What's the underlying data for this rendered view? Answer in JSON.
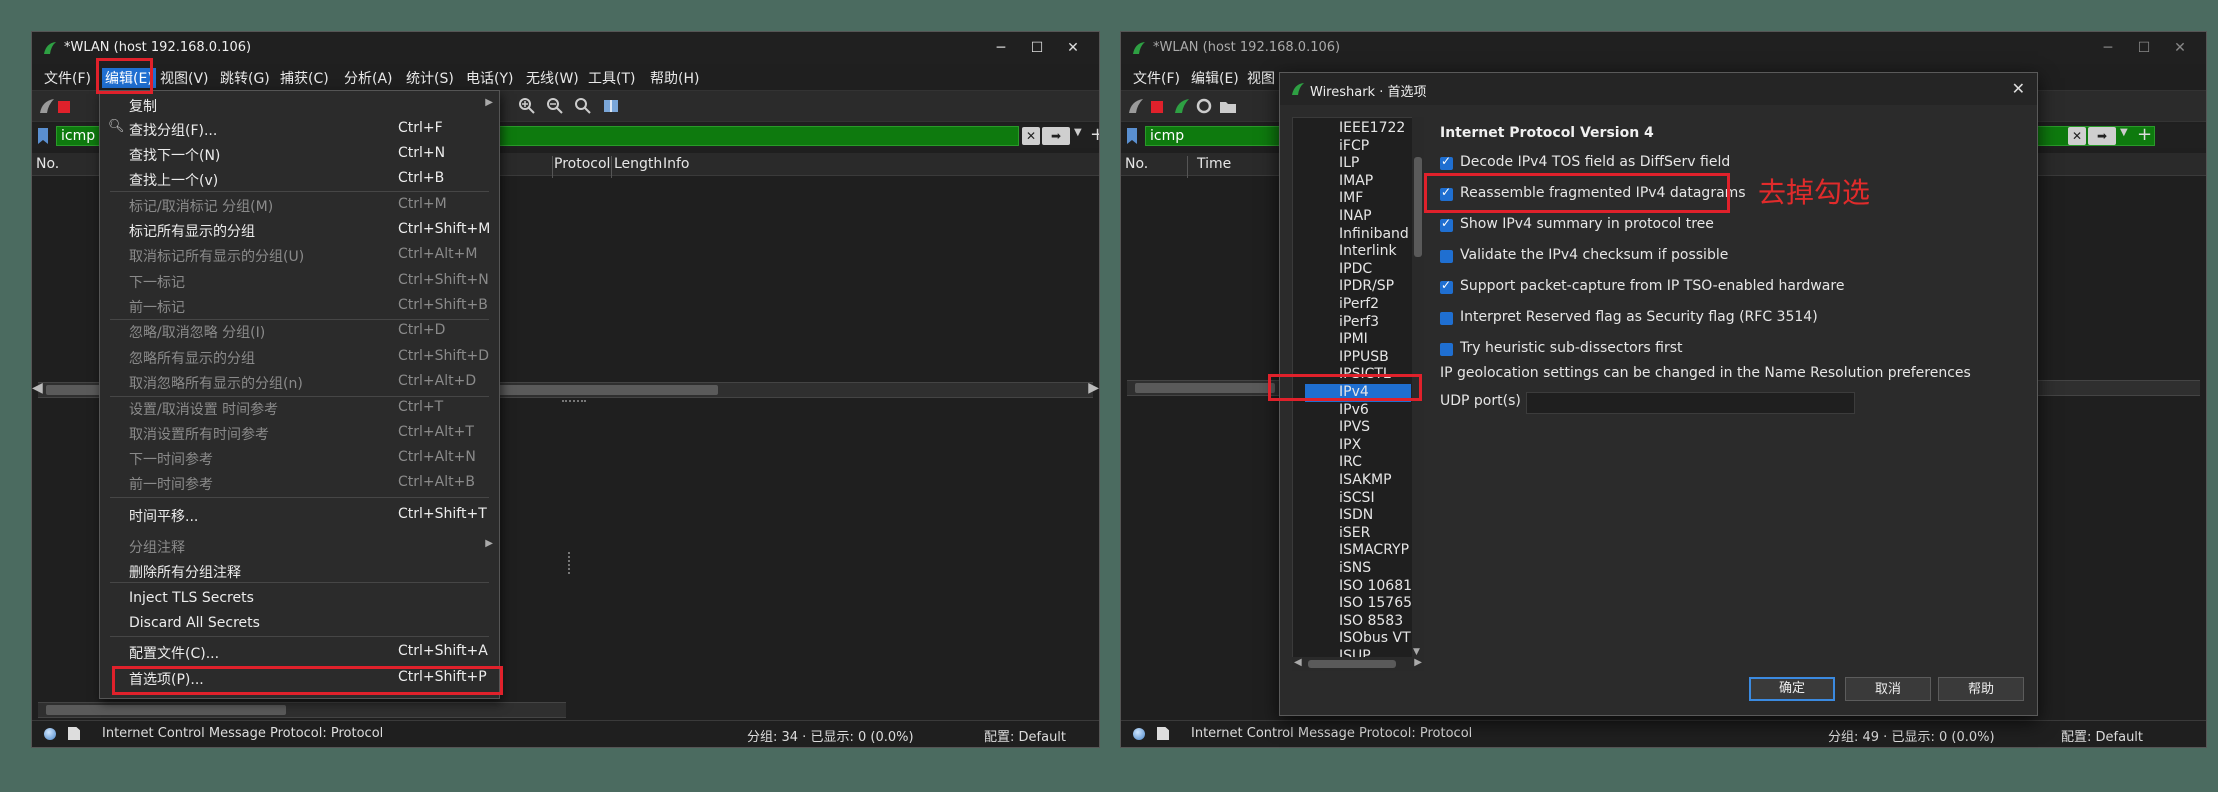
{
  "colors": {
    "accent": "#1f6fd1",
    "filter_green": "#0e7a0e",
    "highlight_red": "#e0212b"
  },
  "window1": {
    "title": "*WLAN (host 192.168.0.106)",
    "menu": [
      "文件(F)",
      "编辑(E)",
      "视图(V)",
      "跳转(G)",
      "捕获(C)",
      "分析(A)",
      "统计(S)",
      "电话(Y)",
      "无线(W)",
      "工具(T)",
      "帮助(H)"
    ],
    "filter_text": "icmp",
    "columns": {
      "no": "No.",
      "protocol": "Protocol",
      "length": "Length",
      "info": "Info"
    },
    "status": {
      "protocol": "Internet Control Message Protocol: Protocol",
      "packets": "分组: 34 · 已显示: 0 (0.0%)",
      "profile": "配置: Default"
    },
    "edit_menu": [
      {
        "label": "复制",
        "shortcut": "",
        "submenu": true,
        "enabled": true
      },
      {
        "label": "查找分组(F)...",
        "shortcut": "Ctrl+F",
        "enabled": true
      },
      {
        "label": "查找下一个(N)",
        "shortcut": "Ctrl+N",
        "enabled": true
      },
      {
        "label": "查找上一个(v)",
        "shortcut": "Ctrl+B",
        "enabled": true
      },
      {
        "label": "标记/取消标记 分组(M)",
        "shortcut": "Ctrl+M",
        "enabled": false
      },
      {
        "label": "标记所有显示的分组",
        "shortcut": "Ctrl+Shift+M",
        "enabled": true
      },
      {
        "label": "取消标记所有显示的分组(U)",
        "shortcut": "Ctrl+Alt+M",
        "enabled": false
      },
      {
        "label": "下一标记",
        "shortcut": "Ctrl+Shift+N",
        "enabled": false
      },
      {
        "label": "前一标记",
        "shortcut": "Ctrl+Shift+B",
        "enabled": false
      },
      {
        "label": "忽略/取消忽略 分组(I)",
        "shortcut": "Ctrl+D",
        "enabled": false
      },
      {
        "label": "忽略所有显示的分组",
        "shortcut": "Ctrl+Shift+D",
        "enabled": false
      },
      {
        "label": "取消忽略所有显示的分组(n)",
        "shortcut": "Ctrl+Alt+D",
        "enabled": false
      },
      {
        "label": "设置/取消设置 时间参考",
        "shortcut": "Ctrl+T",
        "enabled": false
      },
      {
        "label": "取消设置所有时间参考",
        "shortcut": "Ctrl+Alt+T",
        "enabled": false
      },
      {
        "label": "下一时间参考",
        "shortcut": "Ctrl+Alt+N",
        "enabled": false
      },
      {
        "label": "前一时间参考",
        "shortcut": "Ctrl+Alt+B",
        "enabled": false
      },
      {
        "label": "时间平移...",
        "shortcut": "Ctrl+Shift+T",
        "enabled": true
      },
      {
        "label": "分组注释",
        "shortcut": "",
        "submenu": true,
        "enabled": false
      },
      {
        "label": "删除所有分组注释",
        "shortcut": "",
        "enabled": true
      },
      {
        "label": "Inject TLS Secrets",
        "shortcut": "",
        "enabled": true
      },
      {
        "label": "Discard All Secrets",
        "shortcut": "",
        "enabled": true
      },
      {
        "label": "配置文件(C)...",
        "shortcut": "Ctrl+Shift+A",
        "enabled": true
      },
      {
        "label": "首选项(P)...",
        "shortcut": "Ctrl+Shift+P",
        "enabled": true
      }
    ]
  },
  "window2": {
    "title": "*WLAN (host 192.168.0.106)",
    "menu": [
      "文件(F)",
      "编辑(E)",
      "视图"
    ],
    "filter_text": "icmp",
    "columns": {
      "no": "No.",
      "time": "Time"
    },
    "status": {
      "protocol": "Internet Control Message Protocol: Protocol",
      "packets": "分组: 49 · 已显示: 0 (0.0%)",
      "profile": "配置: Default"
    }
  },
  "dialog": {
    "title": "Wireshark · 首选项",
    "tree": [
      "IEEE1722",
      "iFCP",
      "ILP",
      "IMAP",
      "IMF",
      "INAP",
      "Infiniband S",
      "Interlink",
      "IPDC",
      "IPDR/SP",
      "iPerf2",
      "iPerf3",
      "IPMI",
      "IPPUSB",
      "IPSICTL",
      "IPv4",
      "IPv6",
      "IPVS",
      "IPX",
      "IRC",
      "ISAKMP",
      "iSCSI",
      "ISDN",
      "iSER",
      "ISMACRYP",
      "iSNS",
      "ISO 10681",
      "ISO 15765",
      "ISO 8583",
      "ISObus VT",
      "ISUP"
    ],
    "selected": "IPv4",
    "section_title": "Internet Protocol Version 4",
    "options": [
      {
        "label": "Decode IPv4 TOS field as DiffServ field",
        "checked": true
      },
      {
        "label": "Reassemble fragmented IPv4 datagrams",
        "checked": true
      },
      {
        "label": "Show IPv4 summary in protocol tree",
        "checked": true
      },
      {
        "label": "Validate the IPv4 checksum if possible",
        "checked": false
      },
      {
        "label": "Support packet-capture from IP TSO-enabled hardware",
        "checked": true
      },
      {
        "label": "Interpret Reserved flag as Security flag (RFC 3514)",
        "checked": false
      },
      {
        "label": "Try heuristic sub-dissectors first",
        "checked": false
      }
    ],
    "geo_note": "IP geolocation settings can be changed in the Name Resolution preferences",
    "udp_label": "UDP port(s)",
    "udp_value": "",
    "buttons": {
      "ok": "确定",
      "cancel": "取消",
      "help": "帮助"
    }
  },
  "annotation": "去掉勾选"
}
